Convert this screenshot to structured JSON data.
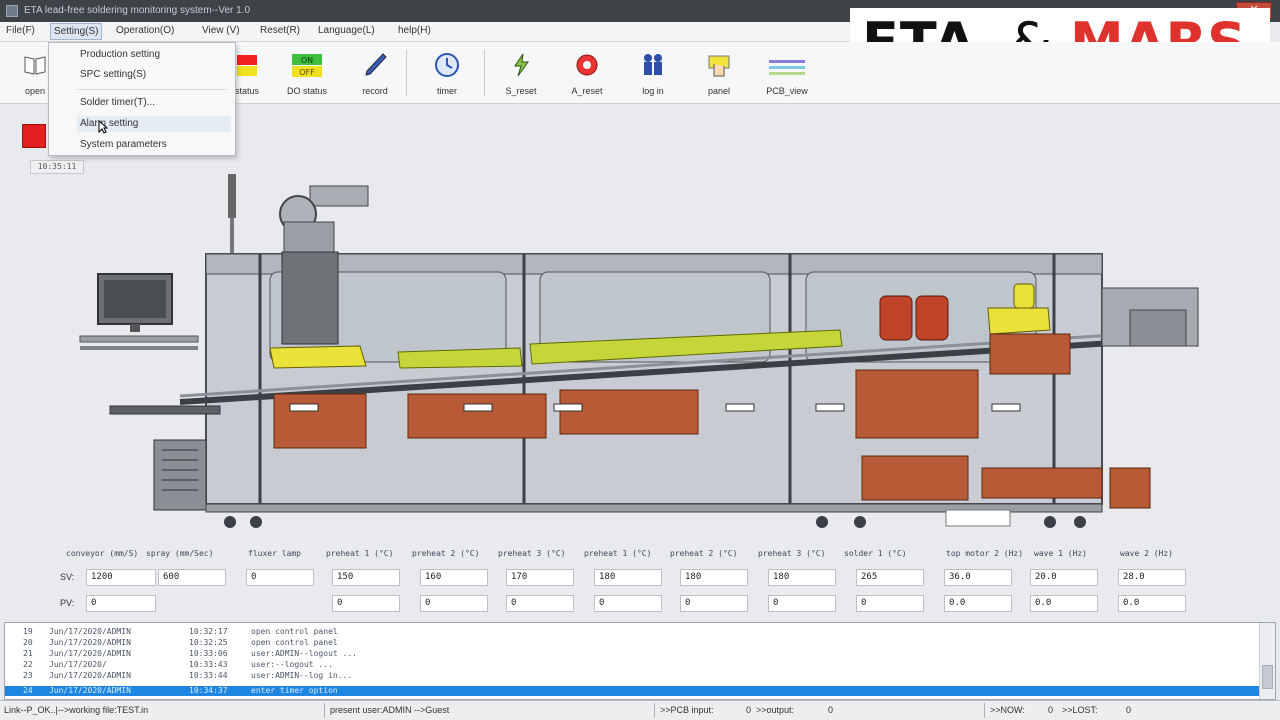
{
  "window": {
    "title": "ETA lead-free soldering monitoring system--Ver 1.0",
    "close_label": "✕"
  },
  "logo": {
    "left": "ETA",
    "amp": "&",
    "right": "MARS"
  },
  "menu": [
    {
      "label": "File(F)"
    },
    {
      "label": "Setting(S)",
      "active": true
    },
    {
      "label": "Operation(O)"
    },
    {
      "label": "View (V)"
    },
    {
      "label": "Reset(R)"
    },
    {
      "label": "Language(L)"
    },
    {
      "label": "help(H)"
    }
  ],
  "toolbar": {
    "open": "open",
    "status": "status",
    "do_status": "DO status",
    "do_on": "ON",
    "do_off": "OFF",
    "record": "record",
    "timer": "timer",
    "s_reset": "S_reset",
    "a_reset": "A_reset",
    "log_in": "log in",
    "panel": "panel",
    "pcb_view": "PCB_view"
  },
  "dropdown": {
    "items": [
      "Production setting",
      "SPC setting(S)",
      "Solder timer(T)...",
      "Alarm setting",
      "System parameters"
    ]
  },
  "clock": "10:35:11",
  "params": {
    "headers": [
      "conveyor (mm/S)",
      "spray (mm/Sec)",
      "fluxer lamp",
      "preheat 1 (°C)",
      "preheat 2 (°C)",
      "preheat 3 (°C)",
      "preheat 1 (°C)",
      "preheat 2 (°C)",
      "preheat 3 (°C)",
      "solder 1 (°C)",
      "top motor 2 (Hz)",
      "wave 1 (Hz)",
      "wave 2 (Hz)"
    ],
    "sv_label": "SV:",
    "pv_label": "PV:",
    "sv": [
      "1200",
      "600",
      "0",
      "150",
      "160",
      "170",
      "180",
      "180",
      "180",
      "265",
      "36.0",
      "20.0",
      "28.0"
    ],
    "pv": [
      "0",
      "",
      "",
      "0",
      "0",
      "0",
      "0",
      "0",
      "0",
      "0",
      "0.0",
      "0.0",
      "0.0"
    ]
  },
  "log": [
    {
      "no": "19",
      "date": "Jun/17/2020/ADMIN",
      "time": "10:32:17",
      "msg": "open control panel"
    },
    {
      "no": "20",
      "date": "Jun/17/2020/ADMIN",
      "time": "10:32:25",
      "msg": "open control panel"
    },
    {
      "no": "21",
      "date": "Jun/17/2020/ADMIN",
      "time": "10:33:06",
      "msg": "user:ADMIN--logout ..."
    },
    {
      "no": "22",
      "date": "Jun/17/2020/",
      "time": "10:33:43",
      "msg": "user:--logout ..."
    },
    {
      "no": "23",
      "date": "Jun/17/2020/ADMIN",
      "time": "10:33:44",
      "msg": "user:ADMIN--log in..."
    },
    {
      "no": "24",
      "date": "Jun/17/2020/ADMIN",
      "time": "10:34:37",
      "msg": "enter timer option",
      "selected": true
    }
  ],
  "status": {
    "link": "Link--P_OK..|-->working file:TEST.in",
    "user": "present user:ADMIN -->Guest",
    "pcb_input": ">>PCB input:",
    "pcb_input_val": "0",
    "output": ">>output:",
    "output_val": "0",
    "now": ">>NOW:",
    "now_val": "0",
    "lost": ">>LOST:",
    "lost_val": "0"
  },
  "colors": {
    "accent_red": "#e0322d",
    "selection_blue": "#1e86e0",
    "machine_orange": "#b85a35",
    "machine_yellow": "#e8e23a"
  }
}
